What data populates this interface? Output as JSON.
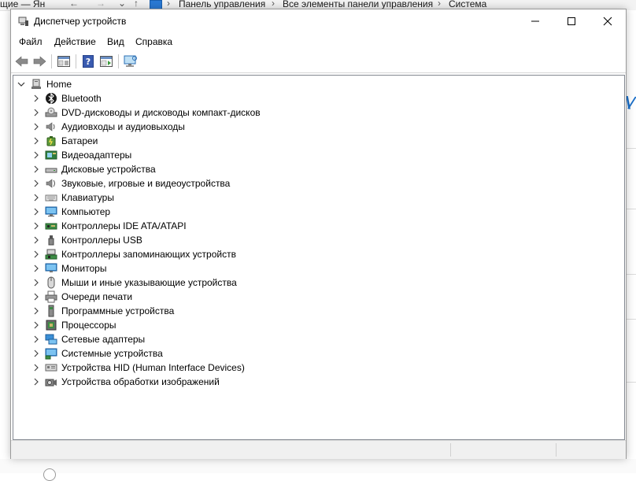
{
  "background_window": {
    "left_fragment": "щие — Ян",
    "breadcrumb": [
      "Панель управления",
      "Все элементы панели управления",
      "Система"
    ]
  },
  "window": {
    "title": "Диспетчер устройств",
    "controls": {
      "minimize": "minimize",
      "maximize": "maximize",
      "close": "close"
    }
  },
  "menu": {
    "items": [
      {
        "label": "Файл"
      },
      {
        "label": "Действие"
      },
      {
        "label": "Вид"
      },
      {
        "label": "Справка"
      }
    ]
  },
  "toolbar": {
    "icons": [
      "back-arrow-icon",
      "forward-arrow-icon",
      "properties-icon",
      "help-icon",
      "update-driver-icon",
      "scan-hardware-icon"
    ]
  },
  "tree": {
    "root": {
      "label": "Home",
      "expanded": true,
      "icon": "computer-icon"
    },
    "items": [
      {
        "label": "Bluetooth",
        "icon": "bluetooth-icon"
      },
      {
        "label": "DVD-дисководы и дисководы компакт-дисков",
        "icon": "dvd-drive-icon"
      },
      {
        "label": "Аудиовходы и аудиовыходы",
        "icon": "speaker-icon"
      },
      {
        "label": "Батареи",
        "icon": "battery-icon"
      },
      {
        "label": "Видеоадаптеры",
        "icon": "display-adapter-icon"
      },
      {
        "label": "Дисковые устройства",
        "icon": "disk-drive-icon"
      },
      {
        "label": "Звуковые, игровые и видеоустройства",
        "icon": "sound-icon"
      },
      {
        "label": "Клавиатуры",
        "icon": "keyboard-icon"
      },
      {
        "label": "Компьютер",
        "icon": "computer-icon"
      },
      {
        "label": "Контроллеры IDE ATA/ATAPI",
        "icon": "ide-controller-icon"
      },
      {
        "label": "Контроллеры USB",
        "icon": "usb-icon"
      },
      {
        "label": "Контроллеры запоминающих устройств",
        "icon": "storage-controller-icon"
      },
      {
        "label": "Мониторы",
        "icon": "monitor-icon"
      },
      {
        "label": "Мыши и иные указывающие устройства",
        "icon": "mouse-icon"
      },
      {
        "label": "Очереди печати",
        "icon": "printer-icon"
      },
      {
        "label": "Программные устройства",
        "icon": "software-device-icon"
      },
      {
        "label": "Процессоры",
        "icon": "processor-icon"
      },
      {
        "label": "Сетевые адаптеры",
        "icon": "network-adapter-icon"
      },
      {
        "label": "Системные устройства",
        "icon": "system-device-icon"
      },
      {
        "label": "Устройства HID (Human Interface Devices)",
        "icon": "hid-icon"
      },
      {
        "label": "Устройства обработки изображений",
        "icon": "imaging-device-icon"
      }
    ]
  }
}
